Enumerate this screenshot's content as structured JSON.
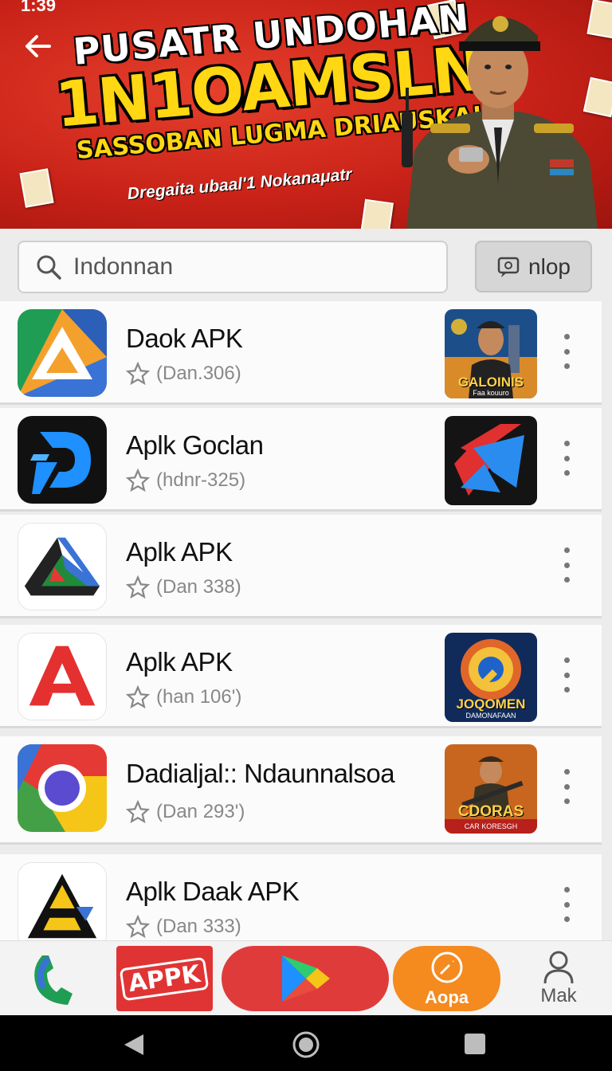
{
  "status_bar": {
    "time": "1:39"
  },
  "banner": {
    "title_line1": "PUSATR UNDOHAN",
    "title_line2": "1N1OAMSLN",
    "title_line3": "SASSOBAN LUGMA DRIAUSKA!",
    "subtitle": "Dregaita ubaal'1 Nokanaμatr"
  },
  "search": {
    "placeholder": "Indonnan",
    "value": ""
  },
  "help_button": {
    "label": "nlop"
  },
  "apps": [
    {
      "name": "Daok APK",
      "rating": "(Dan.306)",
      "thumb": {
        "label": "GALOINIS",
        "sub": "Faa kouuro"
      }
    },
    {
      "name": "Aplk Goclan",
      "rating": "(hdnr-325)",
      "thumb": null
    },
    {
      "name": "Aplk APK",
      "rating": "(Dan 338)",
      "thumb": null
    },
    {
      "name": "Aplk APK",
      "rating": "(han 106')",
      "thumb": {
        "label": "JOQOMEN",
        "sub": "DAMONAFAAN"
      }
    },
    {
      "name": "Dadialjal:: Ndaunnalsoa",
      "rating": "(Dan 293')",
      "thumb": {
        "label": "CDORAS",
        "sub": "CAR KORESGH"
      }
    },
    {
      "name": "Aplk Daak APK",
      "rating": "(Dan 333)",
      "thumb": null
    }
  ],
  "bottom_nav": {
    "apk_label": "APPK",
    "orange_label": "Aopa",
    "profile_label": "Mak"
  },
  "colors": {
    "banner_red": "#c92218",
    "title_yellow": "#ffd712",
    "nav_red": "#e03434",
    "nav_orange": "#f58a1f"
  }
}
